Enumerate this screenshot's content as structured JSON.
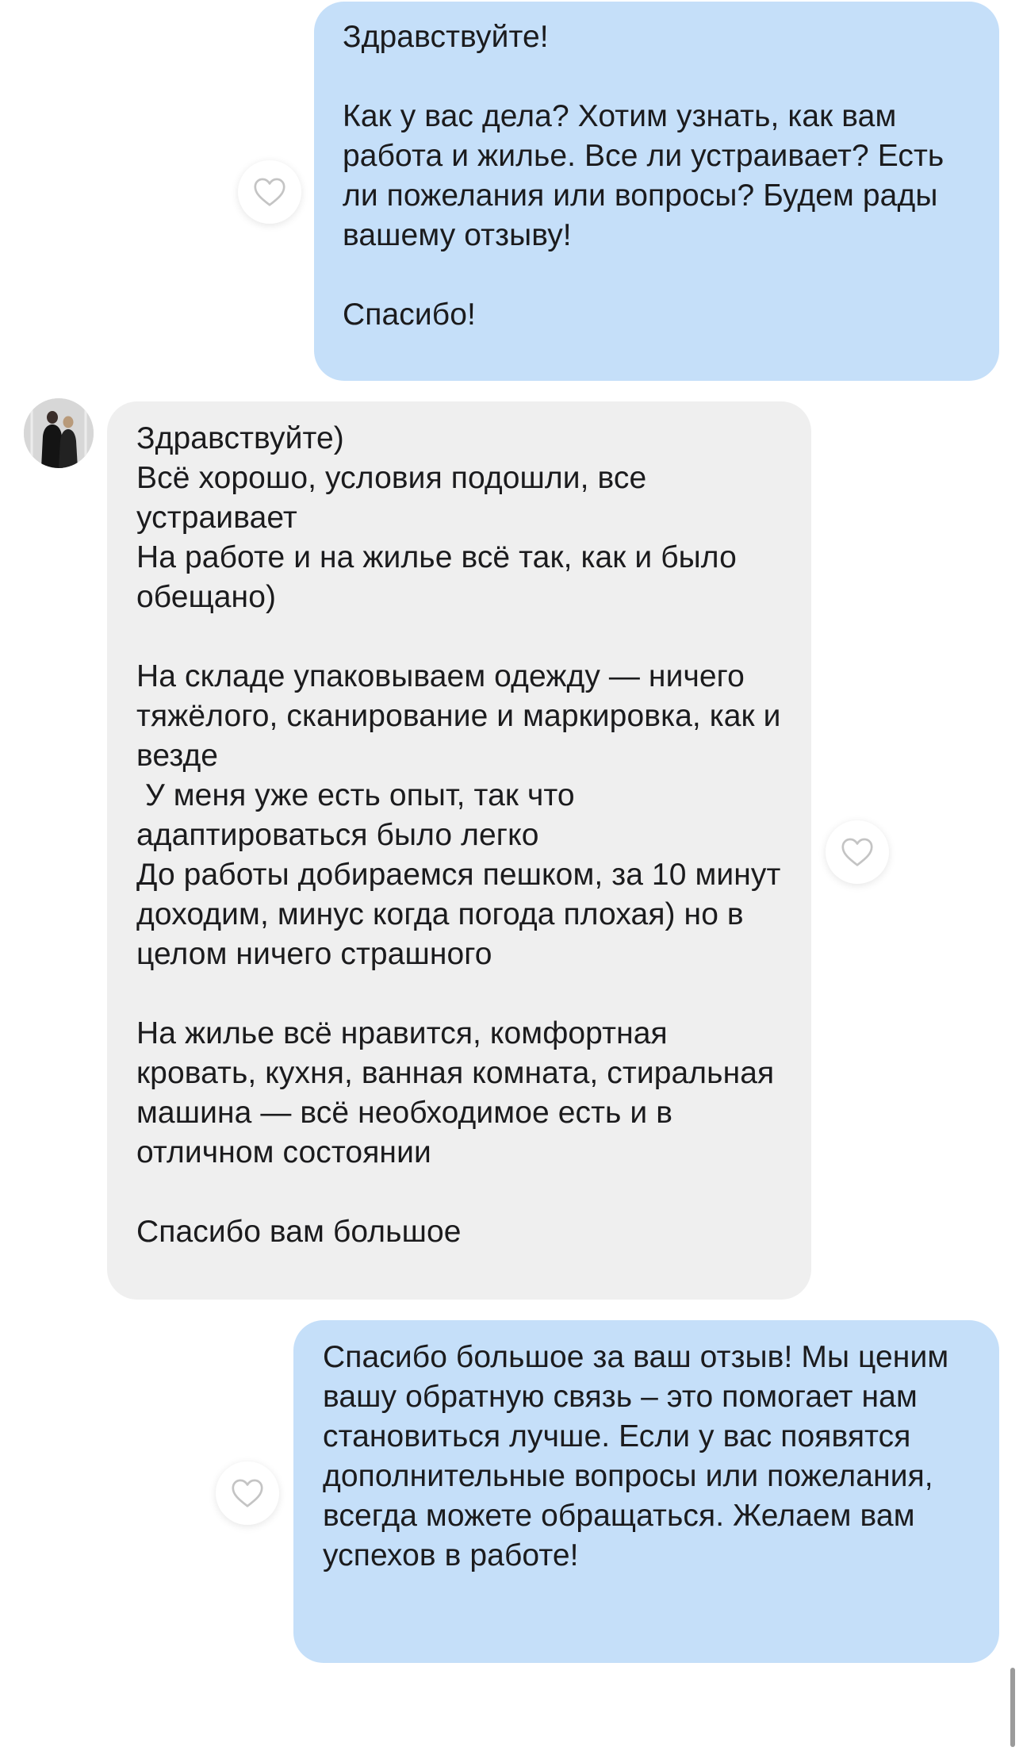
{
  "conversation": {
    "messages": [
      {
        "direction": "outgoing",
        "text": "Здравствуйте!\n\nКак у вас дела? Хотим узнать, как вам работа и жилье. Все ли устраивает? Есть ли пожелания или вопросы? Будем рады вашему отзыву!\n\nСпасибо!",
        "like_icon": "heart-outline-icon"
      },
      {
        "direction": "incoming",
        "avatar_icon": "user-avatar-photo",
        "text": "Здравствуйте)\nВсё хорошо, условия подошли, все устраивает\nНа работе и на жилье всё так, как и было обещано)\n\nНа складе упаковываем одежду — ничего тяжёлого, сканирование и маркировка, как и везде\n У меня уже есть опыт, так что адаптироваться было легко\nДо работы добираемся пешком, за 10 минут доходим, минус когда погода плохая) но в целом ничего страшного\n\nНа жилье всё нравится, комфортная кровать, кухня, ванная комната, стиральная машина — всё необходимое есть и в отличном состоянии\n\nСпасибо вам большое",
        "like_icon": "heart-outline-icon"
      },
      {
        "direction": "outgoing",
        "text": "Спасибо большое за ваш отзыв! Мы ценим вашу обратную связь – это помогает нам становиться лучше. Если у вас появятся дополнительные вопросы или пожелания, всегда можете обращаться. Желаем вам успехов в работе!",
        "like_icon": "heart-outline-icon"
      }
    ]
  },
  "colors": {
    "outgoing_bubble": "#c5dff9",
    "incoming_bubble": "#efefef",
    "text": "#1b1b1d",
    "heart_stroke": "#c4c4c4"
  }
}
